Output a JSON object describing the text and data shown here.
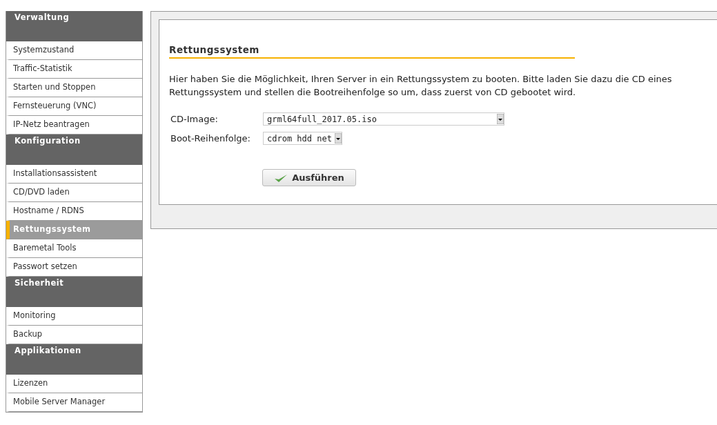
{
  "sidebar": {
    "sections": [
      {
        "title": "Verwaltung",
        "items": [
          {
            "label": "Systemzustand",
            "selected": false
          },
          {
            "label": "Traffic-Statistik",
            "selected": false
          },
          {
            "label": "Starten und Stoppen",
            "selected": false
          },
          {
            "label": "Fernsteuerung (VNC)",
            "selected": false
          },
          {
            "label": "IP-Netz beantragen",
            "selected": false
          }
        ]
      },
      {
        "title": "Konfiguration",
        "items": [
          {
            "label": "Installationsassistent",
            "selected": false
          },
          {
            "label": "CD/DVD laden",
            "selected": false
          },
          {
            "label": "Hostname / RDNS",
            "selected": false
          },
          {
            "label": "Rettungssystem",
            "selected": true
          },
          {
            "label": "Baremetal Tools",
            "selected": false
          },
          {
            "label": "Passwort setzen",
            "selected": false
          }
        ]
      },
      {
        "title": "Sicherheit",
        "items": [
          {
            "label": "Monitoring",
            "selected": false
          },
          {
            "label": "Backup",
            "selected": false
          }
        ]
      },
      {
        "title": "Applikationen",
        "items": [
          {
            "label": "Lizenzen",
            "selected": false
          },
          {
            "label": "Mobile Server Manager",
            "selected": false
          }
        ]
      }
    ]
  },
  "content": {
    "heading": "Rettungssystem",
    "description": "Hier haben Sie die Möglichkeit, Ihren Server in ein Rettungssystem zu booten. Bitte laden Sie dazu die CD eines Rettungssystem und stellen die Bootreihenfolge so um, dass zuerst von CD gebootet wird.",
    "fields": [
      {
        "label": "CD-Image:",
        "value": "grml64full_2017.05.iso",
        "kind": "wide"
      },
      {
        "label": "Boot-Reihenfolge:",
        "value": "cdrom hdd net",
        "kind": "narrow"
      }
    ],
    "button": "Ausführen"
  }
}
